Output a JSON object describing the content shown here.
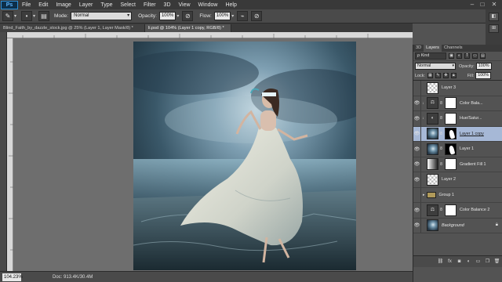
{
  "menubar": {
    "logo": "Ps",
    "items": [
      "File",
      "Edit",
      "Image",
      "Layer",
      "Type",
      "Select",
      "Filter",
      "3D",
      "View",
      "Window",
      "Help"
    ],
    "minimize": "–",
    "maximize": "□",
    "close": "✕"
  },
  "options": {
    "mode_label": "Mode:",
    "mode_value": "Normal",
    "opacity_label": "Opacity:",
    "opacity_value": "100%",
    "flow_label": "Flow:",
    "flow_value": "100%"
  },
  "tabs": [
    {
      "label": "Blind_Faith_by_dazzle_stock.jpg @ 25% (Layer 1, Layer Mask/8) *",
      "active": false
    },
    {
      "label": "li.psd @ 104% (Layer 1 copy, RGB/8) *",
      "active": true
    }
  ],
  "status": {
    "zoom": "104.23%",
    "doc": "Doc: 913.4K/30.4M"
  },
  "dock": {
    "btn1": "◧",
    "btn2": "⊞"
  },
  "layers_panel": {
    "tabs": [
      "3D",
      "Layers",
      "Channels"
    ],
    "kind_label": "ρ Kind",
    "blend_mode": "Normal",
    "opacity_label": "Opacity:",
    "opacity_value": "100%",
    "lock_label": "Lock:",
    "fill_label": "Fill:",
    "fill_value": "100%",
    "layers": [
      {
        "name": "Layer 3",
        "thumb": "checker",
        "mask": false,
        "visible": false,
        "selected": false,
        "italic": false,
        "clipped": false
      },
      {
        "name": "Color Bala...",
        "thumb": "adj",
        "mask": true,
        "visible": true,
        "selected": false,
        "italic": false,
        "clipped": true
      },
      {
        "name": "Hue/Satur...",
        "thumb": "adj",
        "mask": true,
        "visible": true,
        "selected": false,
        "italic": false,
        "clipped": true
      },
      {
        "name": "Layer 1 copy",
        "thumb": "photo",
        "mask": "black",
        "visible": true,
        "selected": true,
        "italic": false,
        "clipped": false
      },
      {
        "name": "Layer 1",
        "thumb": "photo",
        "mask": "black",
        "visible": true,
        "selected": false,
        "italic": false,
        "clipped": false
      },
      {
        "name": "Gradient Fill 1",
        "thumb": "grad",
        "mask": true,
        "visible": true,
        "selected": false,
        "italic": false,
        "clipped": false
      },
      {
        "name": "Layer 2",
        "thumb": "checker",
        "mask": false,
        "visible": true,
        "selected": false,
        "italic": false,
        "clipped": false
      },
      {
        "name": "Group 1",
        "thumb": "folder",
        "mask": false,
        "visible": false,
        "selected": false,
        "italic": false,
        "clipped": false
      },
      {
        "name": "Color Balance 2",
        "thumb": "adj",
        "mask": true,
        "visible": true,
        "selected": false,
        "italic": false,
        "clipped": false
      },
      {
        "name": "Background",
        "thumb": "photo",
        "mask": false,
        "visible": true,
        "selected": false,
        "italic": true,
        "clipped": false
      }
    ],
    "bottom_icons": [
      "link-icon",
      "fx-icon",
      "mask-icon",
      "adjustment-icon",
      "folder-icon",
      "new-layer-icon",
      "trash-icon"
    ]
  },
  "colors": {
    "app_bg": "#535353",
    "menubar": "#393939",
    "canvas_bg": "#6e6e6e",
    "selection": "#a6b8d6"
  }
}
